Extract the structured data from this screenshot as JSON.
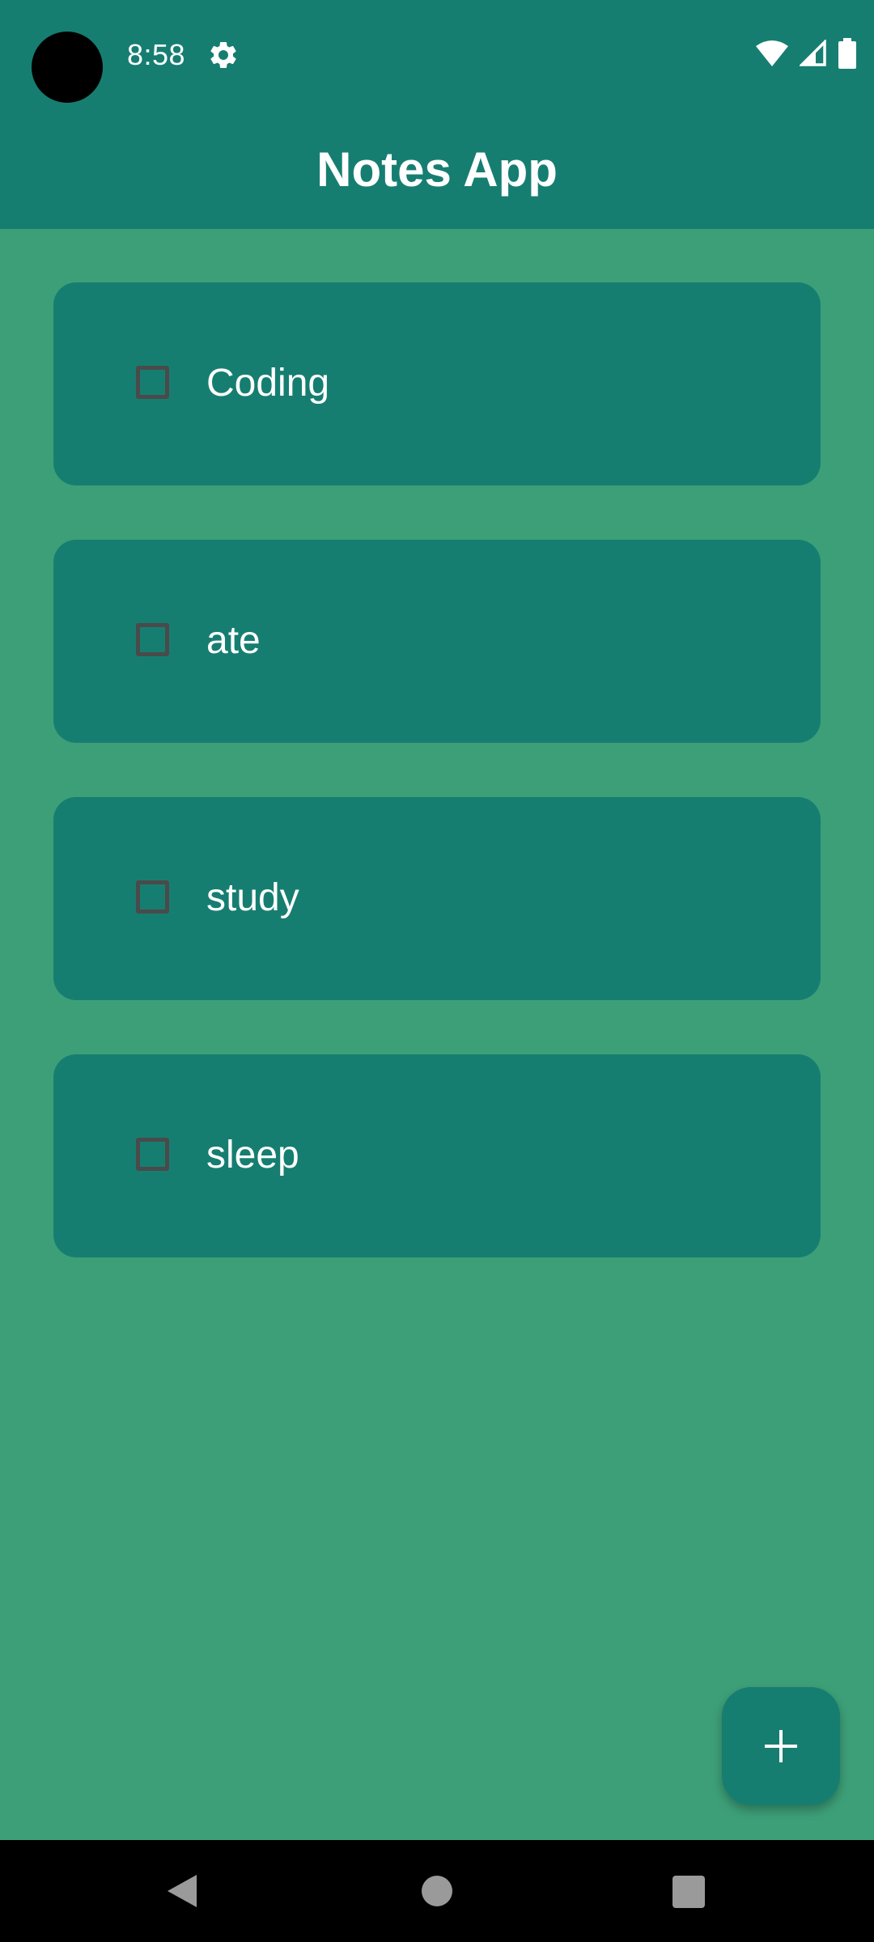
{
  "status_bar": {
    "time": "8:58",
    "icons": [
      "camera-hole",
      "gear-icon",
      "wifi-icon",
      "signal-icon",
      "battery-icon"
    ]
  },
  "app_bar": {
    "title": "Notes App"
  },
  "notes": [
    {
      "text": "Coding",
      "checked": false
    },
    {
      "text": "ate",
      "checked": false
    },
    {
      "text": "study",
      "checked": false
    },
    {
      "text": "sleep",
      "checked": false
    }
  ],
  "fab": {
    "icon": "plus-icon"
  },
  "nav_bar": {
    "icons": [
      "back-icon",
      "home-icon",
      "recents-icon"
    ]
  },
  "colors": {
    "primary": "#167e71",
    "background": "#3d9f78",
    "on_primary": "#ffffff",
    "checkbox_border": "#4a4a4a",
    "nav_bar": "#000000"
  }
}
